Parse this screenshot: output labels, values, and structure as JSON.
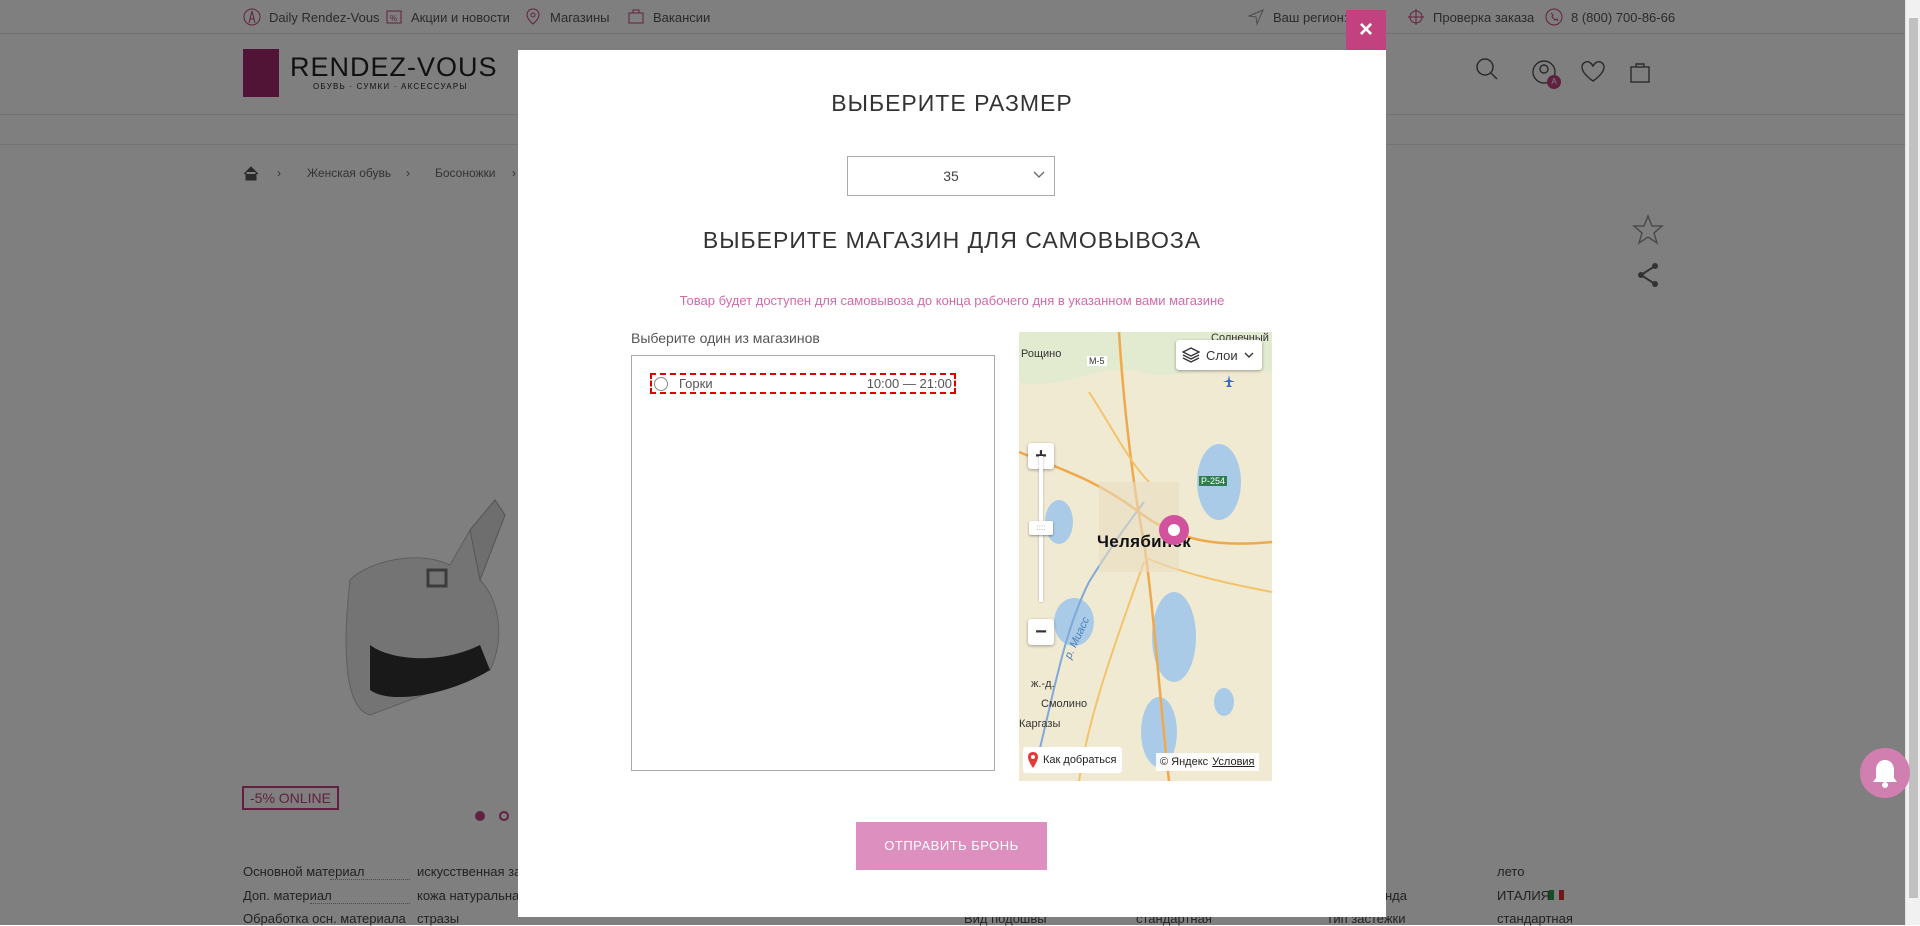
{
  "topbar": {
    "links": [
      "Daily Rendez-Vous",
      "Акции и новости",
      "Магазины",
      "Вакансии"
    ],
    "region": "Ваш регион: Ч",
    "order_check": "Проверка заказа",
    "phone": "8 (800) 700-86-66"
  },
  "header": {
    "logo_title": "RENDEZ-VOUS",
    "logo_subtitle": "ОБУВЬ · СУМКИ · АКСЕССУАРЫ",
    "account_badge": "A"
  },
  "breadcrumb": {
    "items": [
      "Женская обувь",
      "Босоножки"
    ]
  },
  "product": {
    "promo_badge": "-5% ONLINE",
    "specs_left": [
      {
        "label": "Основной материал",
        "value": "искусственная за"
      },
      {
        "label": "Доп. материал",
        "value": "кожа натуральная"
      },
      {
        "label": "Обработка осн. материала",
        "value": "стразы"
      }
    ],
    "specs_mid": [
      {
        "label": "Вид подошвы",
        "value": "стандартная"
      }
    ],
    "specs_right": [
      {
        "label": "нда",
        "value": "ИТАЛИЯ"
      },
      {
        "label": "Тип застежки",
        "value": "стандартная"
      }
    ],
    "specs_right_top": "лето"
  },
  "modal": {
    "close_label": "×",
    "size_title": "ВЫБЕРИТЕ РАЗМЕР",
    "size_value": "35",
    "store_title": "ВЫБЕРИТЕ МАГАЗИН ДЛЯ САМОВЫВОЗА",
    "note": "Товар будет доступен для самовывоза до конца рабочего дня в указанном вами магазине",
    "list_label": "Выберите один из магазинов",
    "stores": [
      {
        "name": "Горки",
        "hours": "10:00 — 21:00"
      }
    ],
    "submit_label": "ОТПРАВИТЬ БРОНЬ",
    "accent_color": "#c2417f",
    "button_color": "#dd8fc0"
  },
  "map": {
    "layers_label": "Слои",
    "zoom_in": "+",
    "zoom_out": "−",
    "city": "Челябинск",
    "places": [
      "Рощино",
      "Солнечный",
      "Смолино",
      "Каргазы",
      "ж.-д.",
      "р. Миасс",
      "М-5",
      "Р-254"
    ],
    "route_label": "Как добраться",
    "copyright": "© Яндекс",
    "terms": "Условия"
  }
}
